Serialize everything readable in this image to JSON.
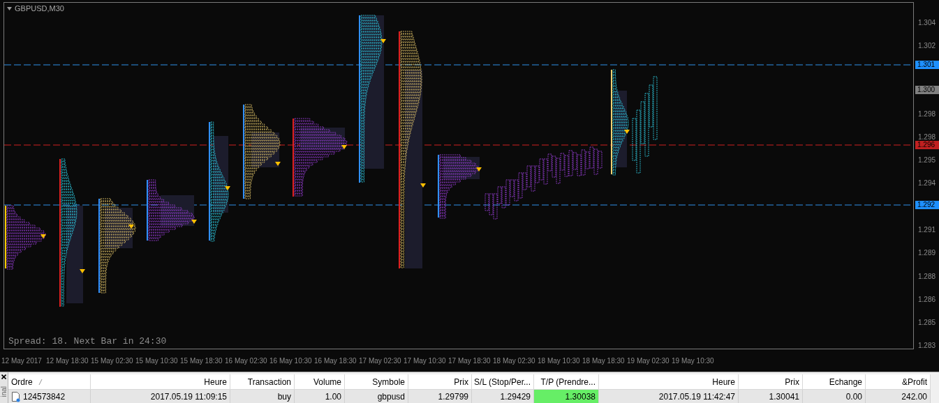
{
  "chart": {
    "title": "GBPUSD,M30",
    "status_text": "Spread: 18. Next Bar in 24:30",
    "price_labels": [
      {
        "text": "1.304",
        "kind": "tick"
      },
      {
        "text": "1.302",
        "kind": "tick"
      },
      {
        "text": "1.301",
        "kind": "badge",
        "color": "#1e90ff"
      },
      {
        "text": "1.300",
        "kind": "badge",
        "color": "#808080"
      },
      {
        "text": "1.298",
        "kind": "tick"
      },
      {
        "text": "1.298",
        "kind": "tick"
      },
      {
        "text": "1.296",
        "kind": "badge",
        "color": "#c02020"
      },
      {
        "text": "1.295",
        "kind": "tick"
      },
      {
        "text": "1.294",
        "kind": "tick"
      },
      {
        "text": "1.292",
        "kind": "badge",
        "color": "#1e90ff"
      },
      {
        "text": "1.291",
        "kind": "tick"
      },
      {
        "text": "1.289",
        "kind": "tick"
      },
      {
        "text": "1.288",
        "kind": "tick"
      },
      {
        "text": "1.286",
        "kind": "tick"
      },
      {
        "text": "1.285",
        "kind": "tick"
      },
      {
        "text": "1.283",
        "kind": "tick"
      }
    ],
    "time_labels": [
      "12 May 2017",
      "12 May 18:30",
      "15 May 02:30",
      "15 May 10:30",
      "15 May 18:30",
      "16 May 02:30",
      "16 May 10:30",
      "16 May 18:30",
      "17 May 02:30",
      "17 May 10:30",
      "17 May 18:30",
      "18 May 02:30",
      "18 May 10:30",
      "18 May 18:30",
      "19 May 02:30",
      "19 May 10:30"
    ]
  },
  "terminal": {
    "side_label": "inal",
    "columns": [
      {
        "label": "Ordre",
        "sorted": true
      },
      {
        "label": "Heure",
        "sorted": false
      },
      {
        "label": "Transaction",
        "sorted": false
      },
      {
        "label": "Volume",
        "sorted": false
      },
      {
        "label": "Symbole",
        "sorted": false
      },
      {
        "label": "Prix",
        "sorted": false
      },
      {
        "label": "S/L (Stop/Per...",
        "sorted": false
      },
      {
        "label": "T/P (Prendre...",
        "sorted": false
      },
      {
        "label": "Heure",
        "sorted": false
      },
      {
        "label": "Prix",
        "sorted": false
      },
      {
        "label": "Echange",
        "sorted": false
      },
      {
        "label": "&Profit",
        "sorted": false
      }
    ],
    "rows": [
      {
        "cells": [
          {
            "text": "124573842",
            "highlighted": false
          },
          {
            "text": "2017.05.19 11:09:15",
            "highlighted": false
          },
          {
            "text": "buy",
            "highlighted": false
          },
          {
            "text": "1.00",
            "highlighted": false
          },
          {
            "text": "gbpusd",
            "highlighted": false
          },
          {
            "text": "1.29799",
            "highlighted": false
          },
          {
            "text": "1.29429",
            "highlighted": false
          },
          {
            "text": "1.30038",
            "highlighted": true
          },
          {
            "text": "2017.05.19 11:42:47",
            "highlighted": false
          },
          {
            "text": "1.30041",
            "highlighted": false
          },
          {
            "text": "0.00",
            "highlighted": false
          },
          {
            "text": "242.00",
            "highlighted": false
          }
        ]
      }
    ]
  }
}
